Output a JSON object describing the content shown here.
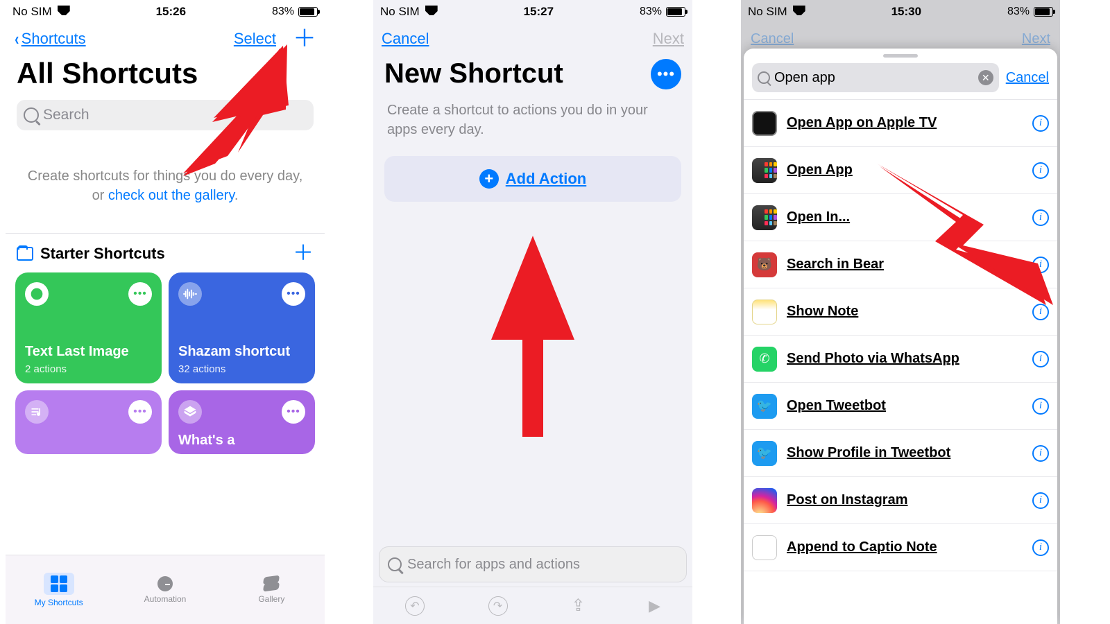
{
  "screens": [
    {
      "statusbar": {
        "carrier": "No SIM",
        "time": "15:26",
        "battery_pct": "83%"
      },
      "nav": {
        "back_label": "Shortcuts",
        "select_label": "Select"
      },
      "title": "All Shortcuts",
      "search_placeholder": "Search",
      "intro_prefix": "Create shortcuts for things you do every day, or ",
      "intro_link": "check out the gallery",
      "intro_suffix": ".",
      "section": "Starter Shortcuts",
      "tiles": [
        {
          "label": "Text Last Image",
          "sub": "2 actions"
        },
        {
          "label": "Shazam shortcut",
          "sub": "32 actions"
        },
        {
          "label": "",
          "sub": ""
        },
        {
          "label": "What's a",
          "sub": ""
        }
      ],
      "tabs": {
        "shortcuts": "My Shortcuts",
        "automation": "Automation",
        "gallery": "Gallery"
      }
    },
    {
      "statusbar": {
        "carrier": "No SIM",
        "time": "15:27",
        "battery_pct": "83%"
      },
      "nav": {
        "cancel": "Cancel",
        "next": "Next"
      },
      "title": "New Shortcut",
      "subtitle": "Create a shortcut to actions you do in your apps every day.",
      "add_action": "Add Action",
      "search_placeholder": "Search for apps and actions"
    },
    {
      "statusbar": {
        "carrier": "No SIM",
        "time": "15:30",
        "battery_pct": "83%"
      },
      "ghost_nav": {
        "cancel": "Cancel",
        "next": "Next"
      },
      "sheet": {
        "search_value": "Open app",
        "cancel": "Cancel",
        "results": [
          "Open App on Apple TV",
          "Open App",
          "Open In...",
          "Search in Bear",
          "Show Note",
          "Send Photo via WhatsApp",
          "Open Tweetbot",
          "Show Profile in Tweetbot",
          "Post on Instagram",
          "Append to Captio Note"
        ]
      }
    }
  ]
}
